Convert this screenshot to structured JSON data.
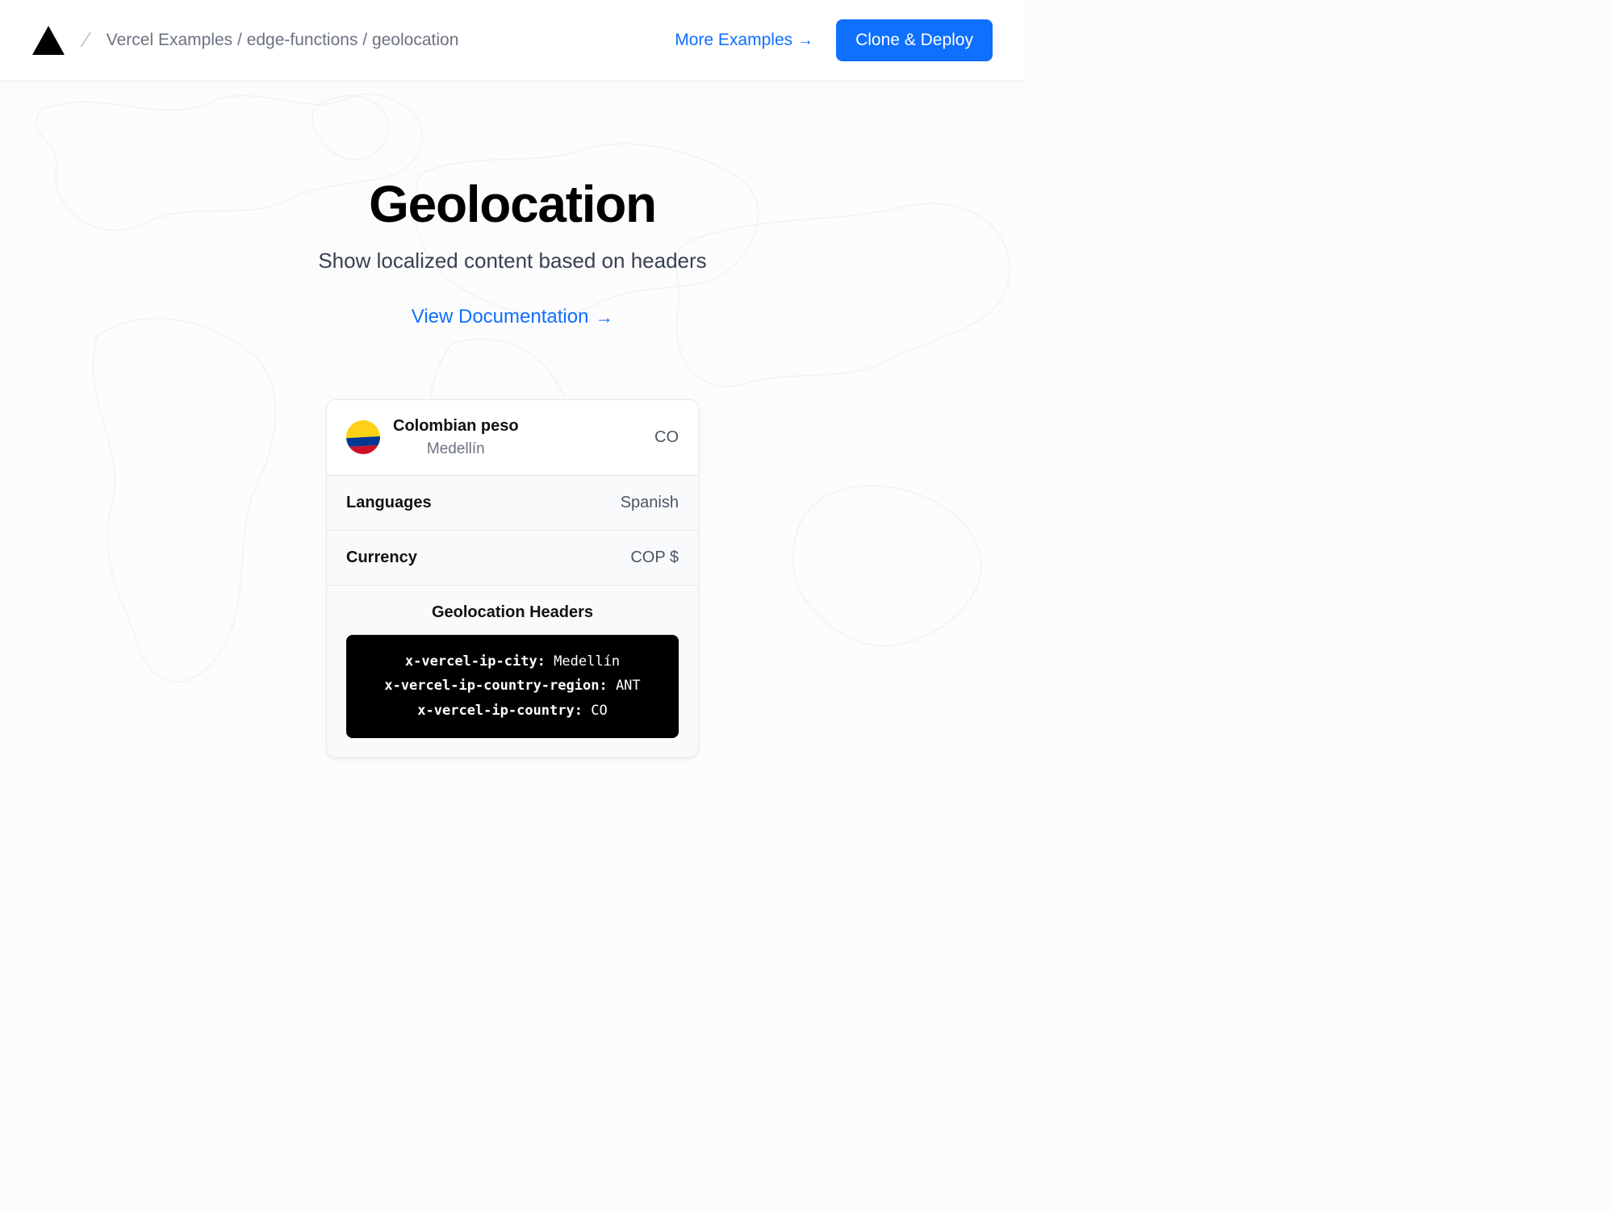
{
  "header": {
    "breadcrumb": "Vercel Examples / edge-functions / geolocation",
    "more_examples": "More Examples",
    "clone_deploy": "Clone & Deploy"
  },
  "hero": {
    "title": "Geolocation",
    "subtitle": "Show localized content based on headers",
    "doc_link": "View Documentation"
  },
  "card": {
    "currency_name": "Colombian peso",
    "city": "Medellín",
    "country_code": "CO",
    "languages_label": "Languages",
    "languages_value": "Spanish",
    "currency_label": "Currency",
    "currency_value": "COP $",
    "headers_title": "Geolocation Headers",
    "headers": [
      {
        "key": "x-vercel-ip-city:",
        "value": "Medellín"
      },
      {
        "key": "x-vercel-ip-country-region:",
        "value": "ANT"
      },
      {
        "key": "x-vercel-ip-country:",
        "value": "CO"
      }
    ]
  },
  "colors": {
    "accent": "#0F6FFF"
  }
}
